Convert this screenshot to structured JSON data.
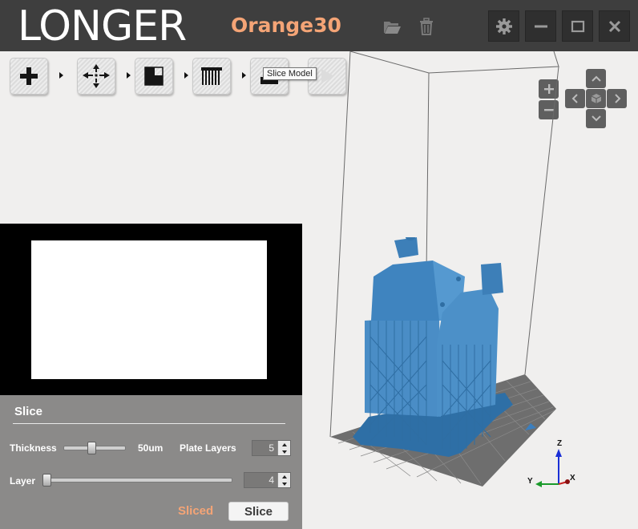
{
  "app": {
    "brand": "LONGER",
    "model_name": "Orange30",
    "accent_color": "#f4a476",
    "titlebar_color": "#3e3e3e"
  },
  "titlebar_icons": [
    "folder-open-icon",
    "trash-icon",
    "gear-icon",
    "minimize-icon",
    "maximize-icon",
    "close-icon"
  ],
  "toolbar": {
    "tools": [
      "add-model-icon",
      "move-icon",
      "support-icon",
      "grid-support-icon",
      "slice-icon",
      "play-icon"
    ],
    "tooltip": "Slice Model"
  },
  "view_controls": [
    "zoom-in-icon",
    "zoom-out-icon",
    "pan-up-icon",
    "pan-left-icon",
    "home-view-icon",
    "pan-right-icon",
    "pan-down-icon"
  ],
  "slice_panel": {
    "title": "Slice",
    "thickness_label": "Thickness",
    "thickness_value": "50um",
    "thickness_fraction": 0.45,
    "plate_layers_label": "Plate Layers",
    "plate_layers_value": "5",
    "layer_label": "Layer",
    "layer_value": "4",
    "layer_fraction": 0.0,
    "status_text": "Sliced",
    "slice_button": "Slice"
  },
  "axes": {
    "z": "Z",
    "y": "Y",
    "x": "X"
  }
}
